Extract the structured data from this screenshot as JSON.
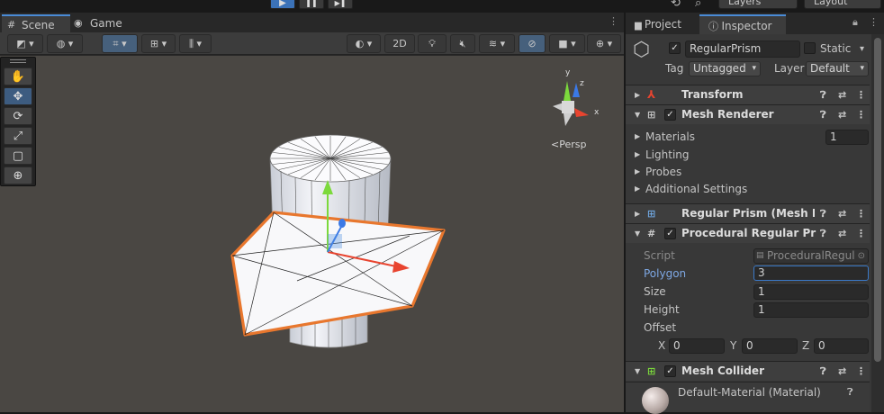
{
  "topbar": {
    "play_glyph": "▶",
    "pause_glyph": "❚❚",
    "step_glyph": "▶❚",
    "history_glyph": "⟲",
    "search_glyph": "⌕",
    "layers": "Layers",
    "layout": "Layout"
  },
  "scene_tabs": {
    "scene": "Scene",
    "game": "Game"
  },
  "scene_toolbar": {
    "mode_2d": "2D",
    "stats_glyph": "▥",
    "tools": [
      "✋",
      "✥",
      "⟳",
      "⤢",
      "▢",
      "⊕"
    ]
  },
  "gizmo": {
    "label": "Persp",
    "axis_x": "x",
    "axis_y": "y",
    "axis_z": "z"
  },
  "inspector": {
    "tab_project": "Project",
    "tab_inspector": "Inspector",
    "object_name": "RegularPrism",
    "static_label": "Static",
    "tag_label": "Tag",
    "tag_value": "Untagged",
    "layer_label": "Layer",
    "layer_value": "Default",
    "components": {
      "transform": "Transform",
      "mesh_renderer": "Mesh Renderer",
      "mesh_filter": "Regular Prism (Mesh Filte",
      "procedural": "Procedural Regular Prism",
      "mesh_collider": "Mesh Collider"
    },
    "mesh_renderer_rows": {
      "materials": "Materials",
      "materials_count": "1",
      "lighting": "Lighting",
      "probes": "Probes",
      "additional": "Additional Settings"
    },
    "procedural_fields": {
      "script_label": "Script",
      "script_value": "ProceduralRegul",
      "polygon_label": "Polygon",
      "polygon_value": "3",
      "size_label": "Size",
      "size_value": "1",
      "height_label": "Height",
      "height_value": "1",
      "offset_label": "Offset",
      "x_label": "X",
      "x_value": "0",
      "y_label": "Y",
      "y_value": "0",
      "z_label": "Z",
      "z_value": "0"
    },
    "material_name": "Default-Material (Material)"
  },
  "colors": {
    "selection_outline": "#e8772e",
    "accent_blue": "#4a8bd6",
    "axis_x": "#e8442f",
    "axis_y": "#7cd93c",
    "axis_z": "#3b79e6"
  }
}
